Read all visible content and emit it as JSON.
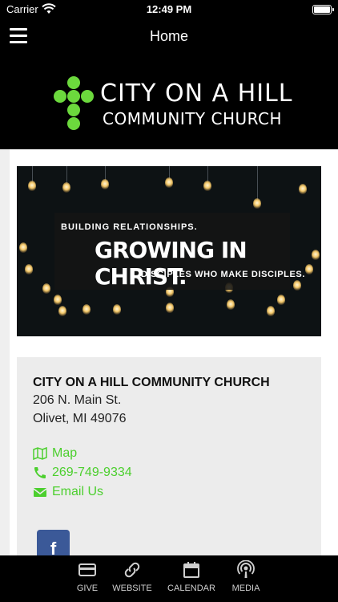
{
  "status_bar": {
    "carrier": "Carrier",
    "time": "12:49 PM",
    "battery_level": 1.0
  },
  "nav": {
    "title": "Home"
  },
  "logo": {
    "line1": "CITY ON A HILL",
    "line2": "COMMUNITY CHURCH",
    "accent_color": "#6cd93d"
  },
  "hero": {
    "line1": "BUILDING RELATIONSHIPS.",
    "line2": "GROWING IN CHRIST.",
    "line3": "DISCIPLES WHO MAKE DISCIPLES."
  },
  "church": {
    "name": "CITY ON A HILL COMMUNITY CHURCH",
    "address_line1": "206 N. Main St.",
    "address_line2": "Olivet, MI 49076"
  },
  "links": {
    "map_label": "Map",
    "phone_label": "269-749-9334",
    "email_label": "Email Us",
    "link_color": "#4ccf2e"
  },
  "social": {
    "facebook_glyph": "f"
  },
  "tabs": [
    {
      "label": "GIVE",
      "icon": "credit-card-icon"
    },
    {
      "label": "WEBSITE",
      "icon": "link-icon"
    },
    {
      "label": "CALENDAR",
      "icon": "calendar-icon"
    },
    {
      "label": "MEDIA",
      "icon": "podcast-icon"
    }
  ]
}
